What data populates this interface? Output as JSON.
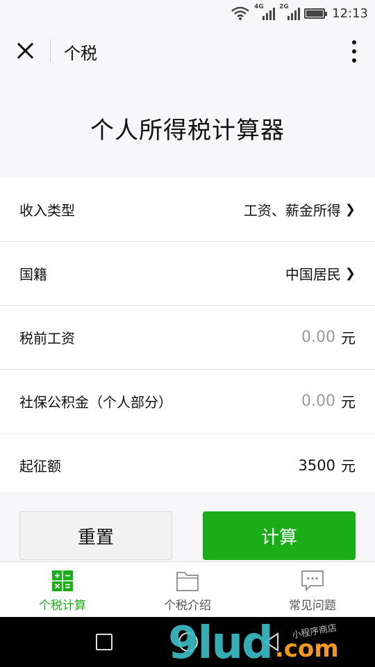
{
  "status_bar": {
    "network1": "4G",
    "network2": "2G",
    "time": "12:13"
  },
  "header": {
    "title": "个税"
  },
  "page": {
    "heading": "个人所得税计算器"
  },
  "form": {
    "income_type": {
      "label": "收入类型",
      "value": "工资、薪金所得"
    },
    "nationality": {
      "label": "国籍",
      "value": "中国居民"
    },
    "pretax_salary": {
      "label": "税前工资",
      "placeholder": "0.00",
      "unit": "元"
    },
    "social_security": {
      "label": "社保公积金（个人部分）",
      "placeholder": "0.00",
      "unit": "元"
    },
    "threshold": {
      "label": "起征额",
      "value": "3500",
      "unit": "元"
    }
  },
  "buttons": {
    "reset": "重置",
    "calculate": "计算"
  },
  "tabs": [
    {
      "label": "个税计算",
      "icon": "calculator-icon",
      "active": true
    },
    {
      "label": "个税介绍",
      "icon": "folder-icon",
      "active": false
    },
    {
      "label": "常见问题",
      "icon": "chat-bubble-icon",
      "active": false
    }
  ],
  "colors": {
    "accent": "#1aad19",
    "background": "#f7f7f9"
  },
  "watermark": {
    "main": "9lud",
    "suffix": ".com",
    "small": "小程序商店"
  }
}
